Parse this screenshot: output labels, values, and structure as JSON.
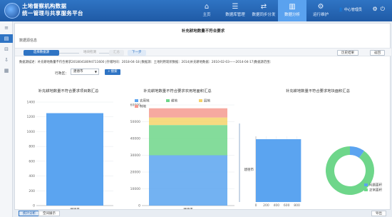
{
  "header": {
    "brand_line1": "土地督察机构数据",
    "brand_line2": "统一管理与共享服务平台",
    "nav": [
      {
        "label": "主页",
        "icon": "home-icon",
        "glyph": "⌂"
      },
      {
        "label": "数据库管理",
        "icon": "database-icon",
        "glyph": "☰"
      },
      {
        "label": "数据同步分发",
        "icon": "share-icon",
        "glyph": "⇄"
      },
      {
        "label": "数据分析",
        "icon": "chart-icon",
        "glyph": "▥"
      },
      {
        "label": "运行维护",
        "icon": "settings-icon",
        "glyph": "⚙"
      }
    ],
    "active_nav": 3,
    "user": "中心管理员",
    "accent": "#2f74c4"
  },
  "sidebar": {
    "icons": [
      {
        "name": "menu-icon",
        "glyph": "≡"
      },
      {
        "name": "list-icon",
        "glyph": "▤"
      },
      {
        "name": "bookmark-icon",
        "glyph": "⊟"
      },
      {
        "name": "download-icon",
        "glyph": "⇩"
      },
      {
        "name": "grid-icon",
        "glyph": "▦"
      }
    ]
  },
  "panel": {
    "title": "补充耕地数量不符合要求",
    "section_label": "数据源信息",
    "steps": {
      "step1": "选择数据源",
      "step2": "地块检测",
      "step3": "汇总",
      "next": "下一步"
    },
    "history_btn": "历史结果",
    "back_btn": "返回",
    "info_text": "数据源描述：补充耕地数量不符合要求20180418094711600 |存储时间：2018-04-18 |数据源：土地利用现状数据：2014|补充耕地数据：2010-02-03——2014-04-17|数据源范围：",
    "filter_label": "行政区：",
    "filter_value": "建德市",
    "search_btn": "搜索"
  },
  "chart_data": [
    {
      "type": "bar",
      "title": "补充耕地数量不符合要求项目数汇总",
      "categories": [
        "建德市"
      ],
      "values": [
        1250
      ],
      "ylim": [
        0,
        1400
      ],
      "yticks": [
        0,
        200,
        400,
        600,
        800,
        1000,
        1200,
        1400
      ],
      "color": "#5ba4f0"
    },
    {
      "type": "bar",
      "title": "补充耕地数量不符合要求农用地面积汇总",
      "categories": [
        "建德市"
      ],
      "stacked": true,
      "series": [
        {
          "name": "农用地",
          "values": [
            30000
          ],
          "color": "#5ba4f0"
        },
        {
          "name": "耕地",
          "values": [
            18000
          ],
          "color": "#6ed68a"
        },
        {
          "name": "园地",
          "values": [
            4500
          ],
          "color": "#f5d36a"
        },
        {
          "name": "林地",
          "values": [
            5500
          ],
          "color": "#f59a8f"
        }
      ],
      "ylim": [
        0,
        60000
      ],
      "yticks": [
        0,
        10000,
        20000,
        30000,
        40000,
        50000,
        60000
      ]
    },
    {
      "type": "bar",
      "orientation": "horizontal",
      "title": "补充耕地数量不符合要求地块面积汇总",
      "categories": [
        "建德市"
      ],
      "values": [
        880
      ],
      "xlim": [
        0,
        1000
      ],
      "xticks": [
        0,
        200,
        400,
        600,
        800
      ],
      "color": "#5ba4f0"
    },
    {
      "type": "pie",
      "donut": true,
      "slices": [
        {
          "name": "问题面积",
          "value": 10,
          "color": "#5ba4f0"
        },
        {
          "name": "正常面积",
          "value": 90,
          "color": "#6ed68a"
        }
      ]
    }
  ],
  "bottom": {
    "tabs": [
      "统计分析",
      "空间展示"
    ],
    "active": 0,
    "export": "导出"
  }
}
